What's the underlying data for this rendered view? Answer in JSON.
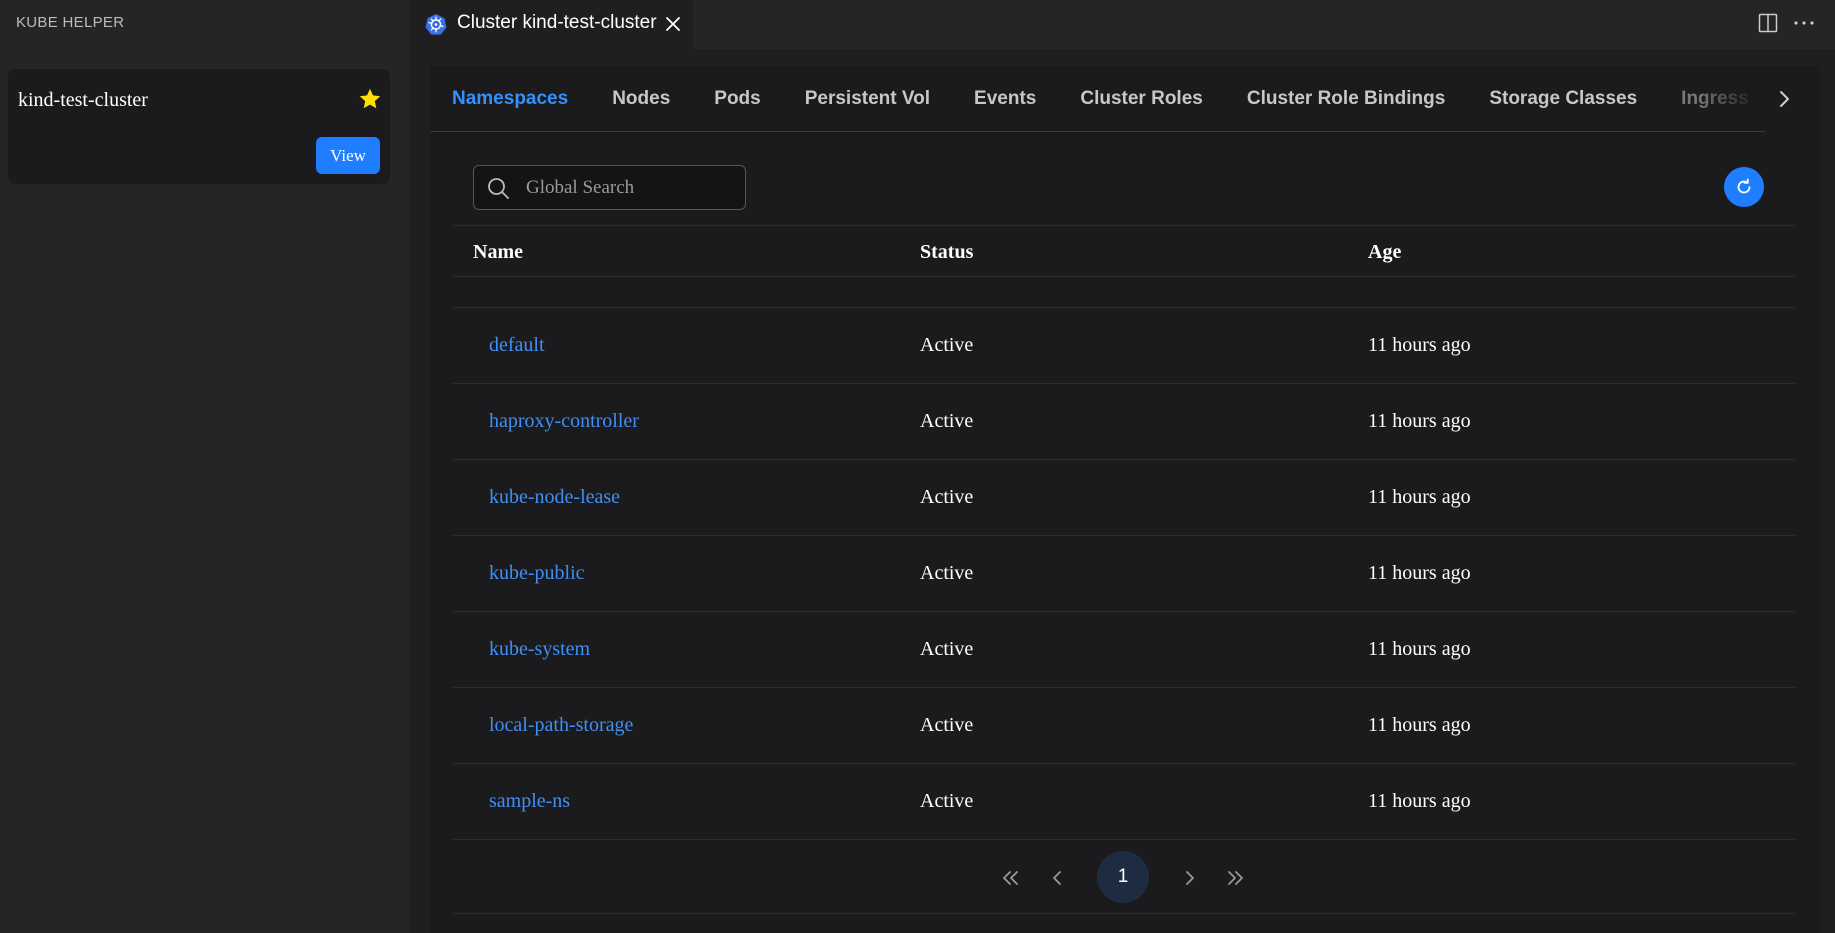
{
  "sidebar": {
    "title": "KUBE HELPER",
    "cluster_card": {
      "name": "kind-test-cluster",
      "favorite": true,
      "view_label": "View"
    }
  },
  "editor": {
    "tab_title": "Cluster kind-test-cluster",
    "tab_icon": "kubernetes-icon"
  },
  "resource_tabs": [
    "Namespaces",
    "Nodes",
    "Pods",
    "Persistent Vol",
    "Events",
    "Cluster Roles",
    "Cluster Role Bindings",
    "Storage Classes",
    "Ingress"
  ],
  "active_tab": "Namespaces",
  "search": {
    "placeholder": "Global Search",
    "value": ""
  },
  "table": {
    "columns": [
      "Name",
      "Status",
      "Age"
    ],
    "rows": [
      {
        "name": "default",
        "status": "Active",
        "age": "11 hours ago"
      },
      {
        "name": "haproxy-controller",
        "status": "Active",
        "age": "11 hours ago"
      },
      {
        "name": "kube-node-lease",
        "status": "Active",
        "age": "11 hours ago"
      },
      {
        "name": "kube-public",
        "status": "Active",
        "age": "11 hours ago"
      },
      {
        "name": "kube-system",
        "status": "Active",
        "age": "11 hours ago"
      },
      {
        "name": "local-path-storage",
        "status": "Active",
        "age": "11 hours ago"
      },
      {
        "name": "sample-ns",
        "status": "Active",
        "age": "11 hours ago"
      }
    ]
  },
  "pagination": {
    "current_page": "1"
  },
  "colors": {
    "accent": "#1f7eff",
    "link": "#3f8ff5",
    "star": "#ffe000"
  }
}
